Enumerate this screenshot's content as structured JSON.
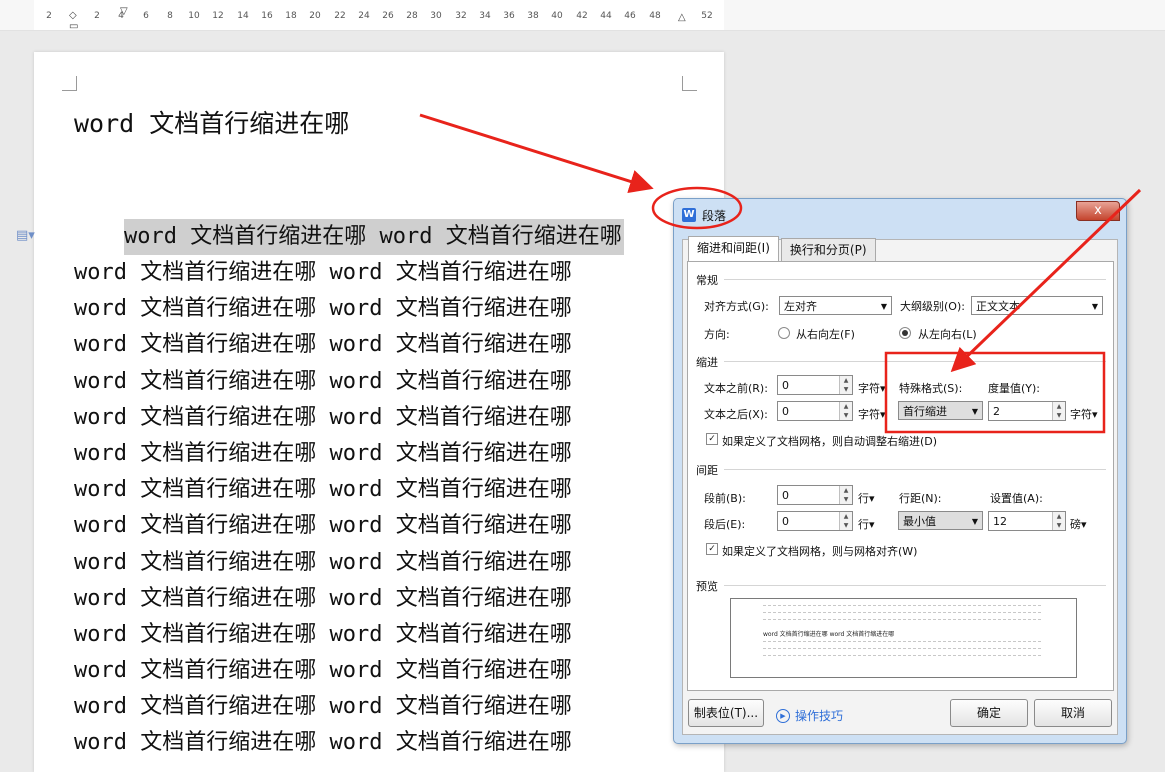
{
  "ruler": {
    "labels": [
      "2",
      "2",
      "4",
      "6",
      "8",
      "10",
      "12",
      "14",
      "16",
      "18",
      "20",
      "22",
      "24",
      "26",
      "28",
      "30",
      "32",
      "34",
      "36",
      "38",
      "40",
      "42",
      "44",
      "46",
      "48",
      "52"
    ]
  },
  "document": {
    "title": "word 文档首行缩进在哪",
    "first_line": "word 文档首行缩进在哪 word 文档首行缩进在哪",
    "body_line": "word 文档首行缩进在哪 word 文档首行缩进在哪",
    "body_line_count": 14
  },
  "dialog": {
    "title": "段落",
    "app_icon": "W",
    "close": "x",
    "tabs": [
      "缩进和间距(I)",
      "换行和分页(P)"
    ],
    "general": {
      "section": "常规",
      "alignment_label": "对齐方式(G):",
      "alignment_value": "左对齐",
      "outline_label": "大纲级别(O):",
      "outline_value": "正文文本",
      "direction_label": "方向:",
      "rtl_label": "从右向左(F)",
      "ltr_label": "从左向右(L)"
    },
    "indent": {
      "section": "缩进",
      "before_label": "文本之前(R):",
      "before_value": "0",
      "before_unit": "字符",
      "after_label": "文本之后(X):",
      "after_value": "0",
      "after_unit": "字符",
      "special_label": "特殊格式(S):",
      "special_value": "首行缩进",
      "measure_label": "度量值(Y):",
      "measure_value": "2",
      "measure_unit": "字符",
      "grid_check_label": "如果定义了文档网格，则自动调整右缩进(D)"
    },
    "spacing": {
      "section": "间距",
      "before_label": "段前(B):",
      "before_value": "0",
      "before_unit": "行",
      "after_label": "段后(E):",
      "after_value": "0",
      "after_unit": "行",
      "line_label": "行距(N):",
      "line_value": "最小值",
      "setting_label": "设置值(A):",
      "setting_value": "12",
      "setting_unit": "磅",
      "grid_check_label": "如果定义了文档网格，则与网格对齐(W)"
    },
    "preview": {
      "section": "预览",
      "sample_text": "word 文档首行缩进在哪 word 文档首行缩进在哪"
    },
    "buttons": {
      "tabs_stop": "制表位(T)...",
      "tips": "操作技巧",
      "ok": "确定",
      "cancel": "取消"
    }
  },
  "annotation_color": "#e8231b"
}
